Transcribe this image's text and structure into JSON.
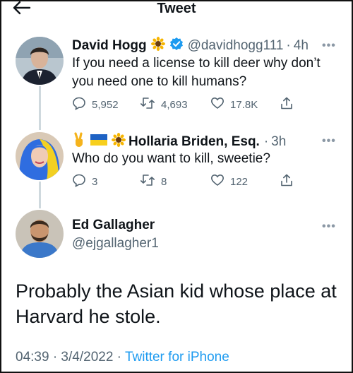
{
  "header": {
    "title": "Tweet"
  },
  "tweets": [
    {
      "name": "David Hogg",
      "handle": "@davidhogg111",
      "sep": "·",
      "time": "4h",
      "text_line1": "If you need a license to kill deer why don’t",
      "text_line2": "you need one to kill humans?",
      "replies": "5,952",
      "retweets": "4,693",
      "likes": "17.8K"
    },
    {
      "name": "Hollaria Briden, Esq.",
      "handle": "",
      "sep": "·",
      "time": "3h",
      "text": "Who do you want to kill, sweetie?",
      "replies": "3",
      "retweets": "8",
      "likes": "122"
    }
  ],
  "main_tweet": {
    "name": "Ed Gallagher",
    "handle": "@ejgallagher1",
    "text": "Probably the Asian kid whose place at Harvard he stole.",
    "date": "04:39 · 3/4/2022 · ",
    "source": "Twitter for iPhone"
  },
  "icons": {
    "back": "back-arrow-icon",
    "verified": "verified-badge-icon",
    "sunflower": "sunflower-emoji",
    "peace": "victory-hand-emoji",
    "flag": "ukraine-flag-emoji",
    "reply": "reply-icon",
    "retweet": "retweet-icon",
    "like": "heart-icon",
    "share": "share-icon",
    "more": "more-dots-icon"
  },
  "colors": {
    "accent": "#1d9bf0",
    "secondary_text": "#536471",
    "verified": "#1d9bf0"
  },
  "more_label": "•••"
}
